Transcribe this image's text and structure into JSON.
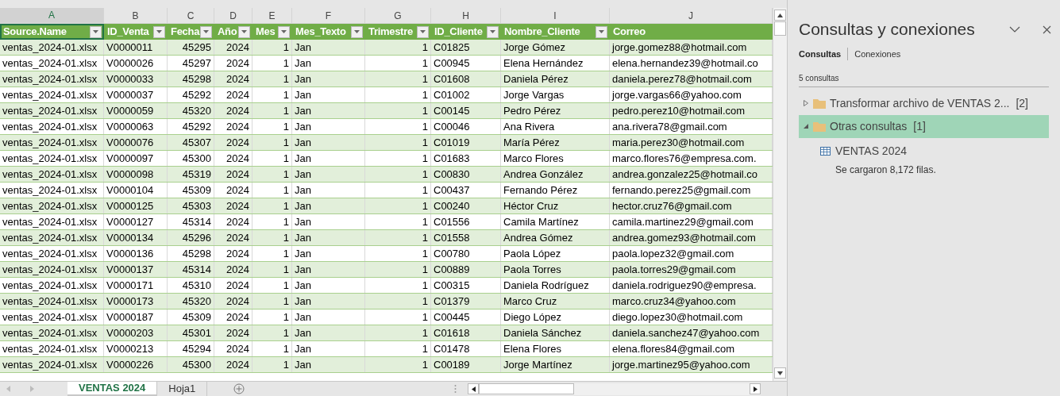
{
  "sheet": {
    "columns": [
      {
        "letter": "A",
        "header": "Source.Name",
        "kind": "text",
        "filter": true,
        "selected": true
      },
      {
        "letter": "B",
        "header": "ID_Venta",
        "kind": "text",
        "filter": true,
        "selected": false
      },
      {
        "letter": "C",
        "header": "Fecha",
        "kind": "number",
        "filter": true,
        "selected": false
      },
      {
        "letter": "D",
        "header": "Año",
        "kind": "number",
        "filter": true,
        "selected": false
      },
      {
        "letter": "E",
        "header": "Mes",
        "kind": "number",
        "filter": true,
        "selected": false
      },
      {
        "letter": "F",
        "header": "Mes_Texto",
        "kind": "text",
        "filter": true,
        "selected": false
      },
      {
        "letter": "G",
        "header": "Trimestre",
        "kind": "number",
        "filter": true,
        "selected": false
      },
      {
        "letter": "H",
        "header": "ID_Cliente",
        "kind": "text",
        "filter": true,
        "selected": false
      },
      {
        "letter": "I",
        "header": "Nombre_Cliente",
        "kind": "text",
        "filter": true,
        "selected": false
      },
      {
        "letter": "J",
        "header": "Correo",
        "kind": "text",
        "filter": false,
        "selected": false
      }
    ],
    "rows": [
      [
        "ventas_2024-01.xlsx",
        "V0000011",
        "45295",
        "2024",
        "1",
        "Jan",
        "1",
        "C01825",
        "Jorge Gómez",
        "jorge.gomez88@hotmail.com"
      ],
      [
        "ventas_2024-01.xlsx",
        "V0000026",
        "45297",
        "2024",
        "1",
        "Jan",
        "1",
        "C00945",
        "Elena Hernández",
        "elena.hernandez39@hotmail.co"
      ],
      [
        "ventas_2024-01.xlsx",
        "V0000033",
        "45298",
        "2024",
        "1",
        "Jan",
        "1",
        "C01608",
        "Daniela Pérez",
        "daniela.perez78@hotmail.com"
      ],
      [
        "ventas_2024-01.xlsx",
        "V0000037",
        "45292",
        "2024",
        "1",
        "Jan",
        "1",
        "C01002",
        "Jorge Vargas",
        "jorge.vargas66@yahoo.com"
      ],
      [
        "ventas_2024-01.xlsx",
        "V0000059",
        "45320",
        "2024",
        "1",
        "Jan",
        "1",
        "C00145",
        "Pedro Pérez",
        "pedro.perez10@hotmail.com"
      ],
      [
        "ventas_2024-01.xlsx",
        "V0000063",
        "45292",
        "2024",
        "1",
        "Jan",
        "1",
        "C00046",
        "Ana Rivera",
        "ana.rivera78@gmail.com"
      ],
      [
        "ventas_2024-01.xlsx",
        "V0000076",
        "45307",
        "2024",
        "1",
        "Jan",
        "1",
        "C01019",
        "María Pérez",
        "maria.perez30@hotmail.com"
      ],
      [
        "ventas_2024-01.xlsx",
        "V0000097",
        "45300",
        "2024",
        "1",
        "Jan",
        "1",
        "C01683",
        "Marco Flores",
        "marco.flores76@empresa.com."
      ],
      [
        "ventas_2024-01.xlsx",
        "V0000098",
        "45319",
        "2024",
        "1",
        "Jan",
        "1",
        "C00830",
        "Andrea González",
        "andrea.gonzalez25@hotmail.co"
      ],
      [
        "ventas_2024-01.xlsx",
        "V0000104",
        "45309",
        "2024",
        "1",
        "Jan",
        "1",
        "C00437",
        "Fernando Pérez",
        "fernando.perez25@gmail.com"
      ],
      [
        "ventas_2024-01.xlsx",
        "V0000125",
        "45303",
        "2024",
        "1",
        "Jan",
        "1",
        "C00240",
        "Héctor Cruz",
        "hector.cruz76@gmail.com"
      ],
      [
        "ventas_2024-01.xlsx",
        "V0000127",
        "45314",
        "2024",
        "1",
        "Jan",
        "1",
        "C01556",
        "Camila Martínez",
        "camila.martinez29@gmail.com"
      ],
      [
        "ventas_2024-01.xlsx",
        "V0000134",
        "45296",
        "2024",
        "1",
        "Jan",
        "1",
        "C01558",
        "Andrea Gómez",
        "andrea.gomez93@hotmail.com"
      ],
      [
        "ventas_2024-01.xlsx",
        "V0000136",
        "45298",
        "2024",
        "1",
        "Jan",
        "1",
        "C00780",
        "Paola López",
        "paola.lopez32@gmail.com"
      ],
      [
        "ventas_2024-01.xlsx",
        "V0000137",
        "45314",
        "2024",
        "1",
        "Jan",
        "1",
        "C00889",
        "Paola Torres",
        "paola.torres29@gmail.com"
      ],
      [
        "ventas_2024-01.xlsx",
        "V0000171",
        "45310",
        "2024",
        "1",
        "Jan",
        "1",
        "C00315",
        "Daniela Rodríguez",
        "daniela.rodriguez90@empresa."
      ],
      [
        "ventas_2024-01.xlsx",
        "V0000173",
        "45320",
        "2024",
        "1",
        "Jan",
        "1",
        "C01379",
        "Marco Cruz",
        "marco.cruz34@yahoo.com"
      ],
      [
        "ventas_2024-01.xlsx",
        "V0000187",
        "45309",
        "2024",
        "1",
        "Jan",
        "1",
        "C00445",
        "Diego López",
        "diego.lopez30@hotmail.com"
      ],
      [
        "ventas_2024-01.xlsx",
        "V0000203",
        "45301",
        "2024",
        "1",
        "Jan",
        "1",
        "C01618",
        "Daniela Sánchez",
        "daniela.sanchez47@yahoo.com"
      ],
      [
        "ventas_2024-01.xlsx",
        "V0000213",
        "45294",
        "2024",
        "1",
        "Jan",
        "1",
        "C01478",
        "Elena Flores",
        "elena.flores84@gmail.com"
      ],
      [
        "ventas_2024-01.xlsx",
        "V0000226",
        "45300",
        "2024",
        "1",
        "Jan",
        "1",
        "C00189",
        "Jorge Martínez",
        "jorge.martinez95@yahoo.com"
      ]
    ],
    "tabs": [
      {
        "label": "VENTAS 2024",
        "selected": true
      },
      {
        "label": "Hoja1",
        "selected": false
      }
    ]
  },
  "panel": {
    "title": "Consultas y conexiones",
    "tabs": [
      {
        "label": "Consultas",
        "selected": true
      },
      {
        "label": "Conexiones",
        "selected": false
      }
    ],
    "count": "5 consultas",
    "groups": [
      {
        "name": "Transformar archivo de VENTAS 2...",
        "count": "[2]",
        "expanded": false,
        "selected": false
      },
      {
        "name": "Otras consultas",
        "count": "[1]",
        "expanded": true,
        "selected": true,
        "children": [
          {
            "name": "VENTAS 2024",
            "status": "Se cargaron 8,172 filas."
          }
        ]
      }
    ]
  }
}
